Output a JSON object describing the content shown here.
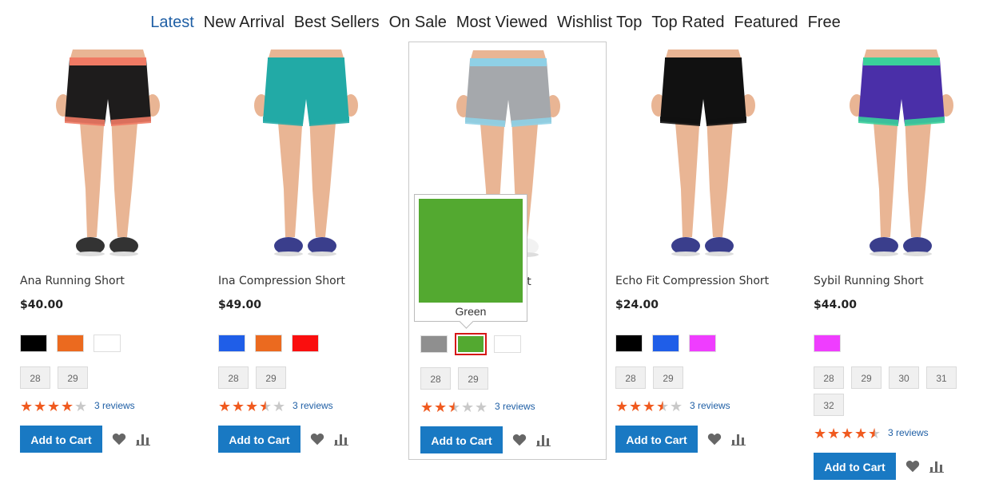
{
  "tabs": [
    {
      "label": "Latest",
      "active": true
    },
    {
      "label": "New Arrival"
    },
    {
      "label": "Best Sellers"
    },
    {
      "label": "On Sale"
    },
    {
      "label": "Most Viewed"
    },
    {
      "label": "Wishlist Top"
    },
    {
      "label": "Top Rated"
    },
    {
      "label": "Featured"
    },
    {
      "label": "Free"
    }
  ],
  "colors": {
    "accent": "#1979c3",
    "star": "#f05a1f",
    "star_empty": "#c9c9c9",
    "tab_active": "#1f5fa5"
  },
  "products": [
    {
      "name": "Ana Running Short",
      "price": "$40.00",
      "swatches": [
        {
          "color": "#000000"
        },
        {
          "color": "#eb6a1f"
        },
        {
          "color": "#ffffff"
        }
      ],
      "sizes": [
        "28",
        "29"
      ],
      "rating": 4,
      "reviews": "3 reviews",
      "cart_label": "Add to Cart",
      "short_color": "#1e1c1c",
      "trim_color": "#f07a64",
      "shoe_color": "#333333"
    },
    {
      "name": "Ina Compression Short",
      "price": "$49.00",
      "swatches": [
        {
          "color": "#1f5ee8"
        },
        {
          "color": "#eb6a1f"
        },
        {
          "color": "#fa0e0e"
        }
      ],
      "sizes": [
        "28",
        "29"
      ],
      "rating": 3.5,
      "reviews": "3 reviews",
      "cart_label": "Add to Cart",
      "short_color": "#22aaa6",
      "trim_color": "#22aaa6",
      "shoe_color": "#3a3e8c"
    },
    {
      "name": "Erika Running Short",
      "price": "",
      "swatches": [
        {
          "color": "#8f8f8f"
        },
        {
          "color": "#53a930",
          "selected": true
        },
        {
          "color": "#ffffff"
        }
      ],
      "sizes": [
        "28",
        "29"
      ],
      "rating": 2.5,
      "reviews": "3 reviews",
      "cart_label": "Add to Cart",
      "short_color": "#a5a8ac",
      "trim_color": "#8fd0e6",
      "shoe_color": "#f2f2f2",
      "hover": true,
      "tooltip": {
        "label": "Green",
        "color": "#53a930"
      }
    },
    {
      "name": "Echo Fit Compression Short",
      "price": "$24.00",
      "swatches": [
        {
          "color": "#000000"
        },
        {
          "color": "#1f5ee8"
        },
        {
          "color": "#ef3dff"
        }
      ],
      "sizes": [
        "28",
        "29"
      ],
      "rating": 3.5,
      "reviews": "3 reviews",
      "cart_label": "Add to Cart",
      "short_color": "#111111",
      "trim_color": "#111111",
      "shoe_color": "#3a3e8c"
    },
    {
      "name": "Sybil Running Short",
      "price": "$44.00",
      "swatches": [
        {
          "color": "#ef3dff"
        }
      ],
      "sizes": [
        "28",
        "29",
        "30",
        "31",
        "32"
      ],
      "rating": 4.5,
      "reviews": "3 reviews",
      "cart_label": "Add to Cart",
      "short_color": "#4a2fa8",
      "trim_color": "#3ad09a",
      "shoe_color": "#3a3e8c"
    }
  ]
}
